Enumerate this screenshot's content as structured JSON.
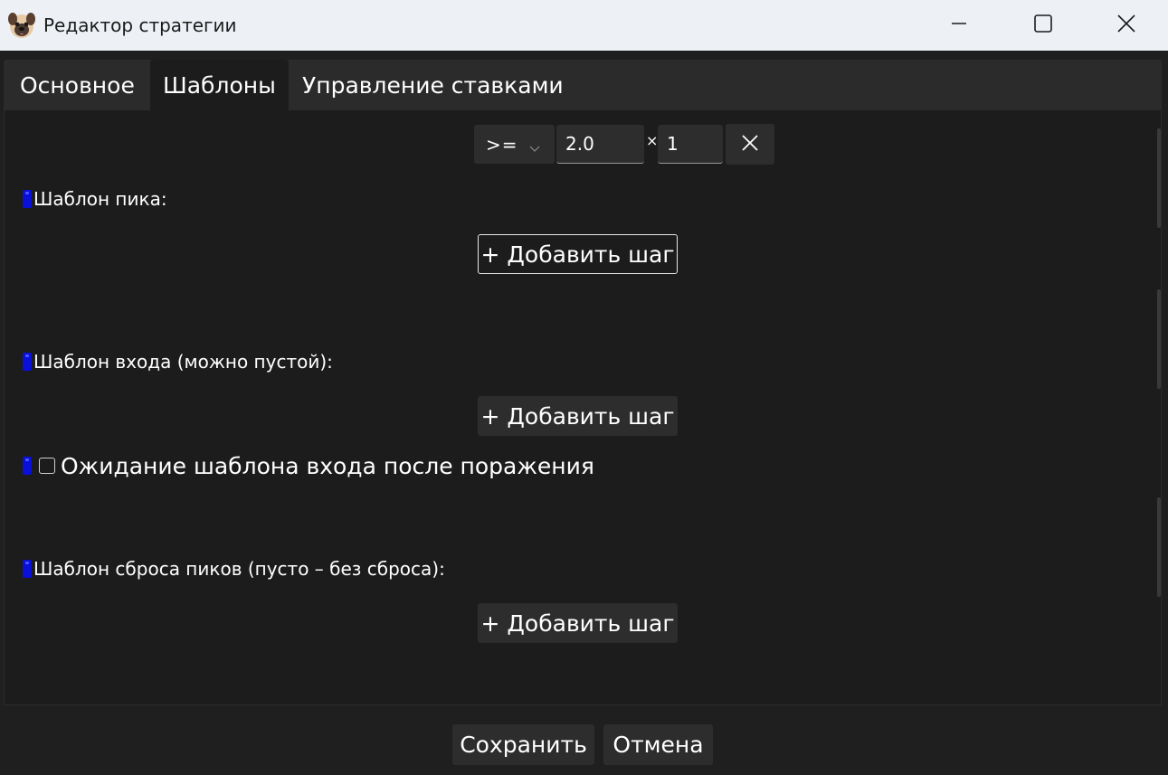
{
  "window": {
    "title": "Редактор стратегии",
    "app_icon": "pug-face-icon",
    "controls": [
      "minimize-icon",
      "maximize-icon",
      "close-icon"
    ]
  },
  "tabs": [
    {
      "label": "Основное",
      "active": false
    },
    {
      "label": "Шаблоны",
      "active": true
    },
    {
      "label": "Управление ставками",
      "active": false
    }
  ],
  "condition_row": {
    "operator": ">=",
    "value": "2.0",
    "times_sign": "×",
    "multiplier": "1",
    "remove_icon": "close-icon"
  },
  "sections": {
    "peak_label": "Шаблон пика:",
    "entry_label": "Шаблон входа (можно пустой):",
    "wait_checkbox_label": "Ожидание шаблона входа после поражения",
    "wait_checkbox_checked": false,
    "reset_label": "Шаблон сброса пиков (пусто – без сброса):",
    "add_step_label": "+ Добавить шаг"
  },
  "footer": {
    "save_label": "Сохранить",
    "cancel_label": "Отмена"
  },
  "colors": {
    "background": "#1f1f1f",
    "panel": "#1c1c1c",
    "control": "#2d2d2d",
    "titlebar": "#edf1f6",
    "info_mark": "#0a10d8"
  }
}
